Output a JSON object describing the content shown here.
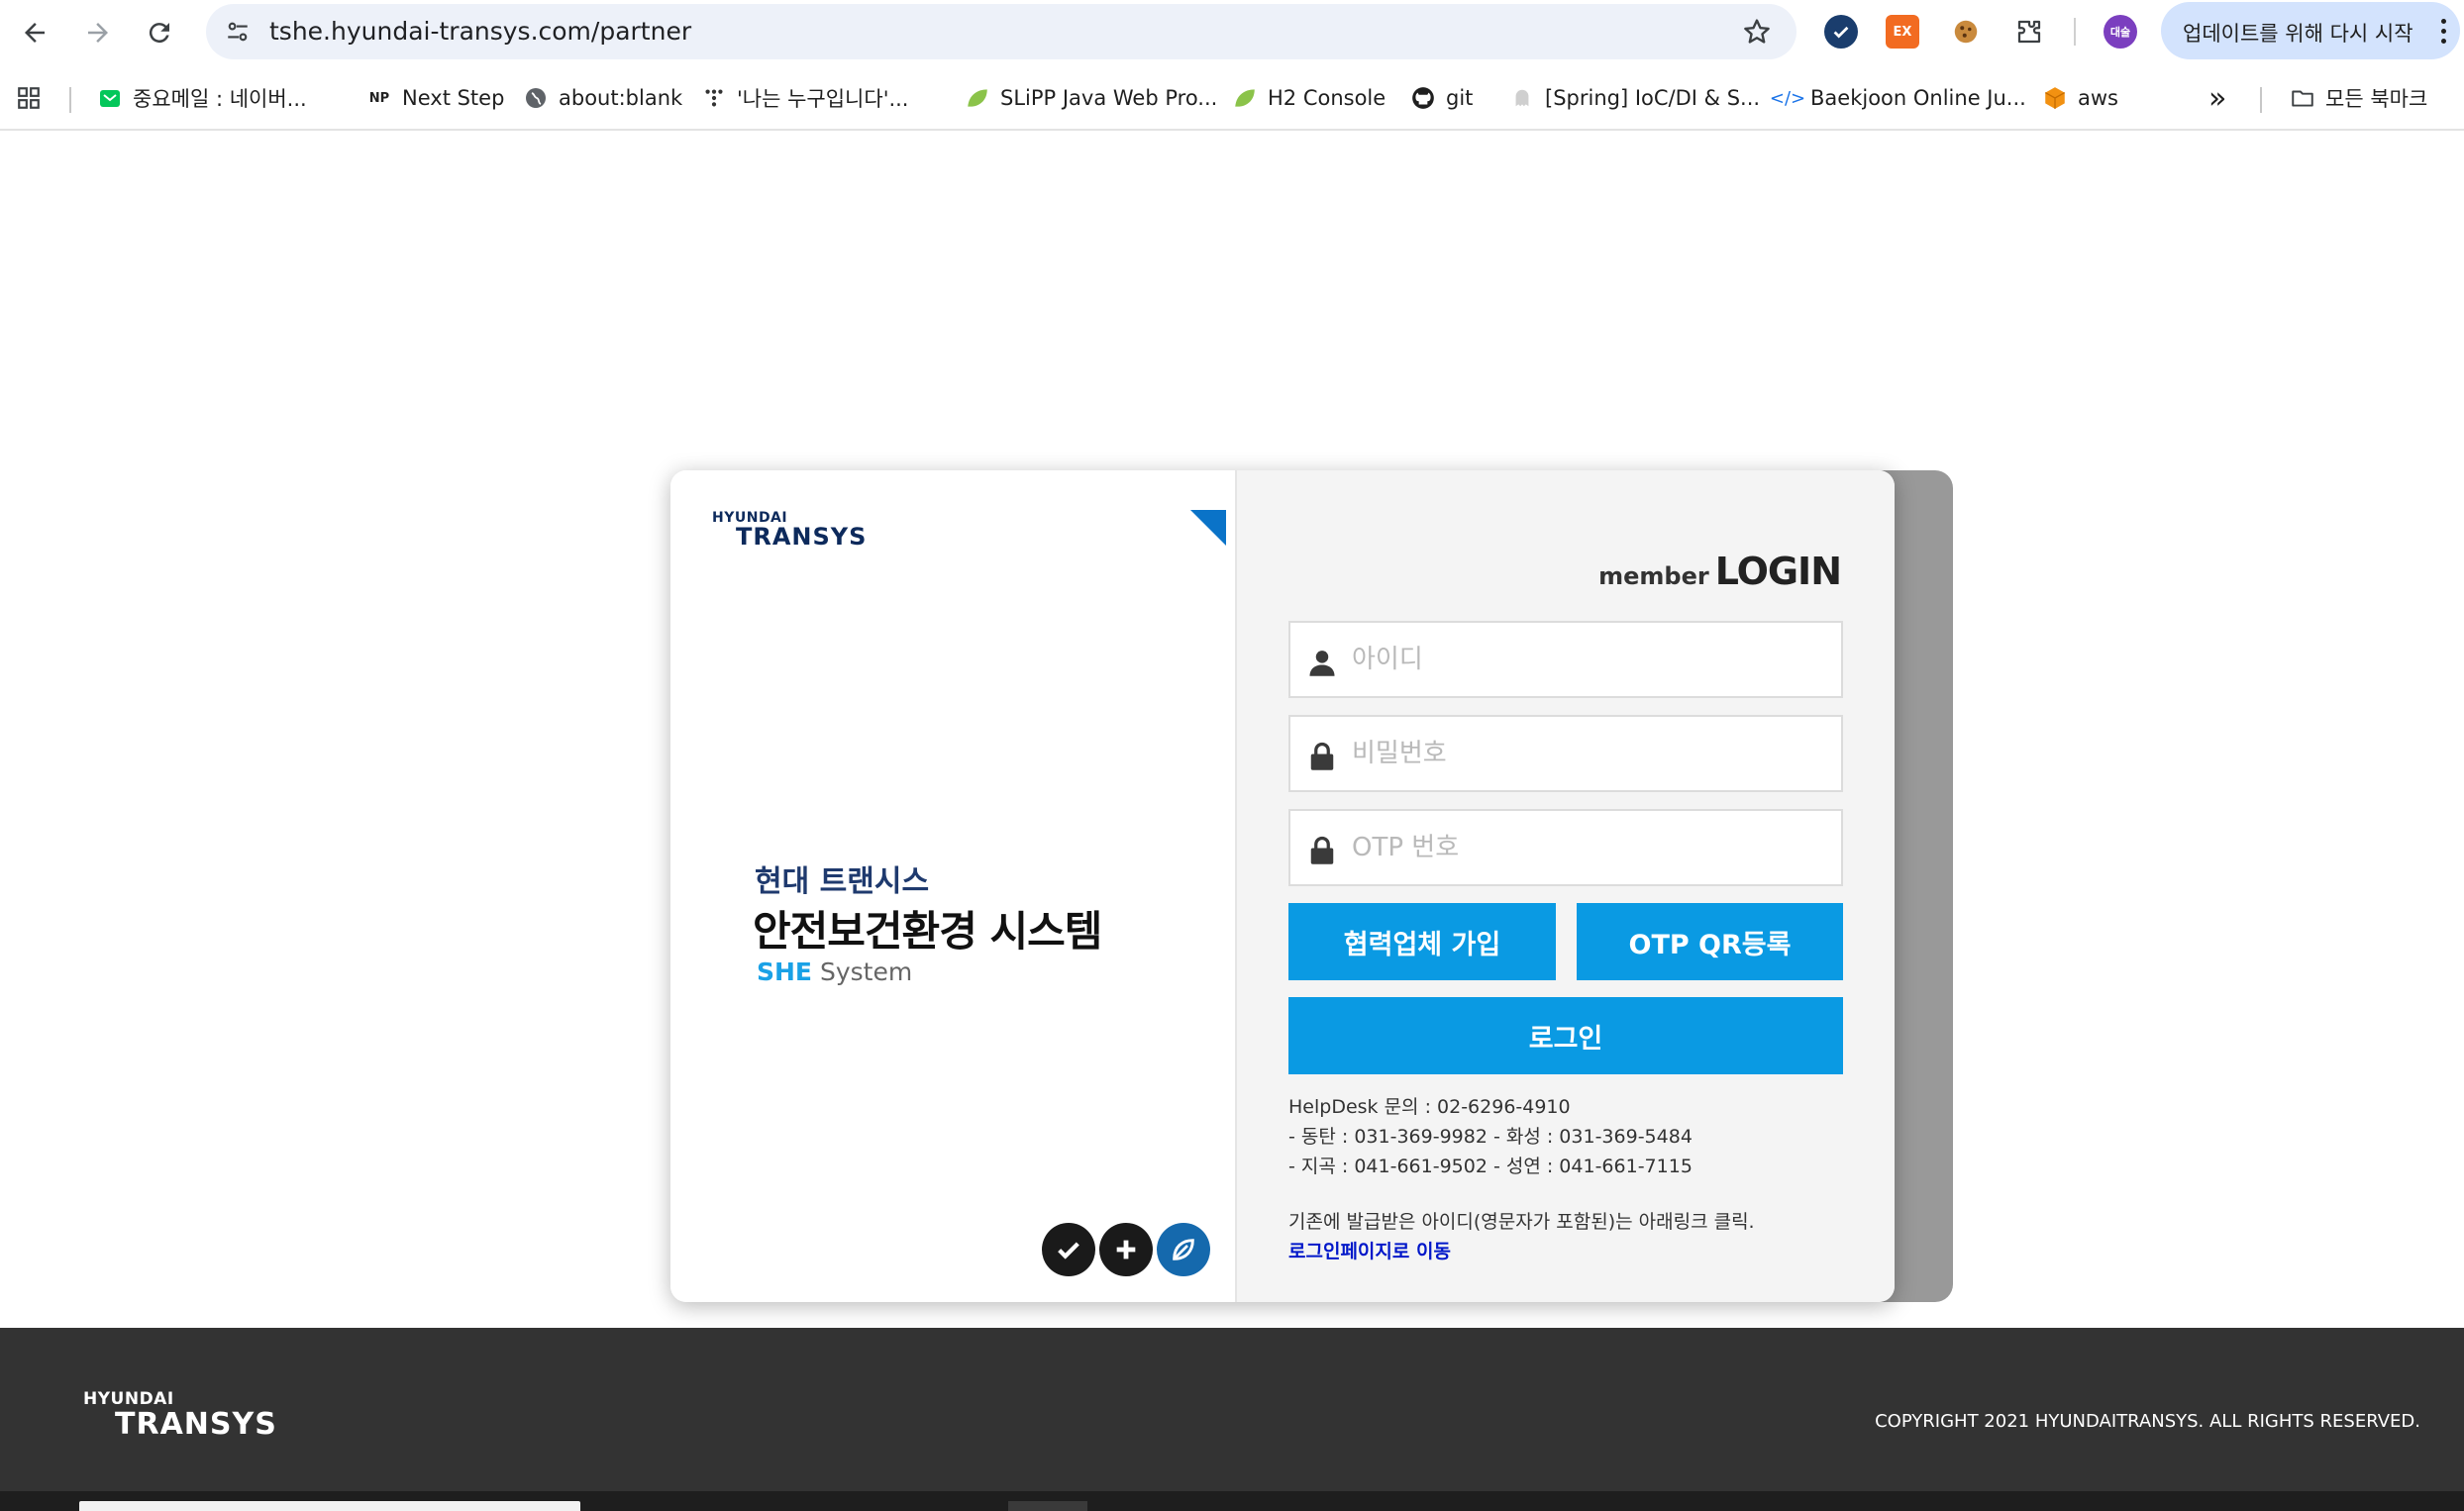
{
  "browser": {
    "url": "tshe.hyundai-transys.com/partner",
    "profile_label": "대술",
    "update_label": "업데이트를 위해 다시 시작",
    "extensions": [
      {
        "name": "check-extension",
        "label": ""
      },
      {
        "name": "ex-extension",
        "label": "EX"
      },
      {
        "name": "cookie-extension",
        "label": ""
      },
      {
        "name": "puzzle-extension",
        "label": ""
      }
    ],
    "bookmarks": [
      {
        "label": "중요메일 : 네이버...",
        "icon": "naver-mail-icon"
      },
      {
        "label": "Next Step",
        "icon": "np-icon"
      },
      {
        "label": "about:blank",
        "icon": "globe-icon"
      },
      {
        "label": "'나는 누구입니다'...",
        "icon": "dots-icon"
      },
      {
        "label": "SLiPP Java Web Pro...",
        "icon": "leaf-icon"
      },
      {
        "label": "H2 Console",
        "icon": "leaf-icon"
      },
      {
        "label": "git",
        "icon": "github-icon"
      },
      {
        "label": "[Spring] IoC/DI & S...",
        "icon": "ghost-icon"
      },
      {
        "label": "Baekjoon Online Ju...",
        "icon": "code-icon"
      },
      {
        "label": "aws",
        "icon": "cube-icon"
      }
    ],
    "overflow_label": "»",
    "all_bookmarks_label": "모든 북마크"
  },
  "brand": {
    "logo_small": "HYUNDAI",
    "logo_big": "TRANSYS"
  },
  "hero": {
    "subtitle": "현대 트랜시스",
    "title": "안전보건환경 시스템",
    "tag_she": "SHE",
    "tag_system": "System",
    "badges": [
      "check-badge-icon",
      "plus-badge-icon",
      "leaf-badge-icon"
    ]
  },
  "login": {
    "heading_small": "member",
    "heading_big": "LOGIN",
    "id_placeholder": "아이디",
    "password_placeholder": "비밀번호",
    "otp_placeholder": "OTP 번호",
    "join_button": "협력업체 가입",
    "otp_qr_button": "OTP QR등록",
    "login_button": "로그인",
    "helpdesk": [
      "HelpDesk 문의 : 02-6296-4910",
      "- 동탄 : 031-369-9982 - 화성 : 031-369-5484",
      "- 지곡 : 041-661-9502 - 성연 : 041-661-7115"
    ],
    "legacy_text": "기존에 발급받은 아이디(영문자가 포함된)는 아래링크 클릭.",
    "legacy_link": "로그인페이지로 이동"
  },
  "footer": {
    "logo_small": "HYUNDAI",
    "logo_big": "TRANSYS",
    "copyright": "COPYRIGHT 2021 HYUNDAITRANSYS. ALL RIGHTS RESERVED."
  },
  "colors": {
    "accent": "#0a9ae3",
    "brand_navy": "#0d2a5c",
    "footer_bg": "#333333",
    "link": "#0017c9"
  }
}
